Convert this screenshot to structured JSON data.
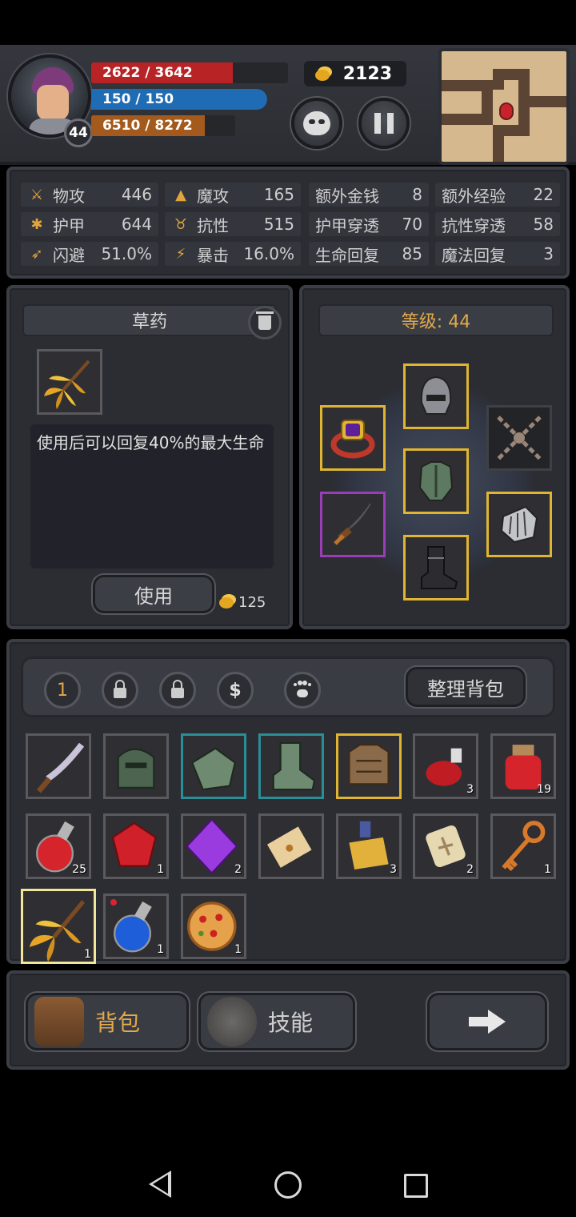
{
  "player": {
    "level": "44",
    "hp": "2622 / 3642",
    "hp_fraction": 0.72,
    "mp": "150 / 150",
    "mp_fraction": 1.0,
    "xp": "6510 / 8272",
    "xp_fraction": 0.79,
    "gold": "2123"
  },
  "stats": [
    {
      "label": "物攻",
      "value": "446",
      "icon": "sword-icon"
    },
    {
      "label": "魔攻",
      "value": "165",
      "icon": "wizard-hat-icon"
    },
    {
      "label": "额外金钱",
      "value": "8",
      "icon": ""
    },
    {
      "label": "额外经验",
      "value": "22",
      "icon": ""
    },
    {
      "label": "护甲",
      "value": "644",
      "icon": "paw-icon"
    },
    {
      "label": "抗性",
      "value": "515",
      "icon": "horns-icon"
    },
    {
      "label": "护甲穿透",
      "value": "70",
      "icon": ""
    },
    {
      "label": "抗性穿透",
      "value": "58",
      "icon": ""
    },
    {
      "label": "闪避",
      "value": "51.0%",
      "icon": "running-icon"
    },
    {
      "label": "暴击",
      "value": "16.0%",
      "icon": "lightning-icon"
    },
    {
      "label": "生命回复",
      "value": "85",
      "icon": ""
    },
    {
      "label": "魔法回复",
      "value": "3",
      "icon": ""
    }
  ],
  "selected_item": {
    "name": "草药",
    "description": "使用后可以回复40%的最大生命",
    "use_label": "使用",
    "price": "125"
  },
  "equipment": {
    "level_label": "等级: 44"
  },
  "inventory": {
    "tab_active": "1",
    "sort_label": "整理背包",
    "items": [
      {
        "name": "curved-dagger",
        "qty": "",
        "rarity": "normal"
      },
      {
        "name": "green-helmet",
        "qty": "",
        "rarity": "normal"
      },
      {
        "name": "green-gauntlets",
        "qty": "",
        "rarity": "teal"
      },
      {
        "name": "green-boots",
        "qty": "",
        "rarity": "teal"
      },
      {
        "name": "leather-armor",
        "qty": "",
        "rarity": "gold"
      },
      {
        "name": "red-potion-small",
        "qty": "3",
        "rarity": "normal"
      },
      {
        "name": "red-potion-jar",
        "qty": "19",
        "rarity": "normal"
      },
      {
        "name": "red-potion-flask",
        "qty": "25",
        "rarity": "normal"
      },
      {
        "name": "ruby",
        "qty": "1",
        "rarity": "normal"
      },
      {
        "name": "amethyst",
        "qty": "2",
        "rarity": "normal"
      },
      {
        "name": "scroll",
        "qty": "",
        "rarity": "normal"
      },
      {
        "name": "magic-scroll",
        "qty": "3",
        "rarity": "normal"
      },
      {
        "name": "rune-stone",
        "qty": "2",
        "rarity": "normal"
      },
      {
        "name": "key",
        "qty": "1",
        "rarity": "normal"
      },
      {
        "name": "herb",
        "qty": "1",
        "rarity": "selected"
      },
      {
        "name": "blue-potion",
        "qty": "1",
        "rarity": "normal"
      },
      {
        "name": "pizza",
        "qty": "1",
        "rarity": "normal"
      }
    ]
  },
  "nav": {
    "bag_label": "背包",
    "skills_label": "技能",
    "next_icon": "arrow-right-icon"
  },
  "colors": {
    "hp": "#b82426",
    "mp": "#1f6cb5",
    "xp": "#a35a1c",
    "gold_text": "#e1a94b",
    "rare_gold": "#e0b531",
    "rare_teal": "#2a8e96",
    "rare_purple": "#9b3cb8"
  }
}
